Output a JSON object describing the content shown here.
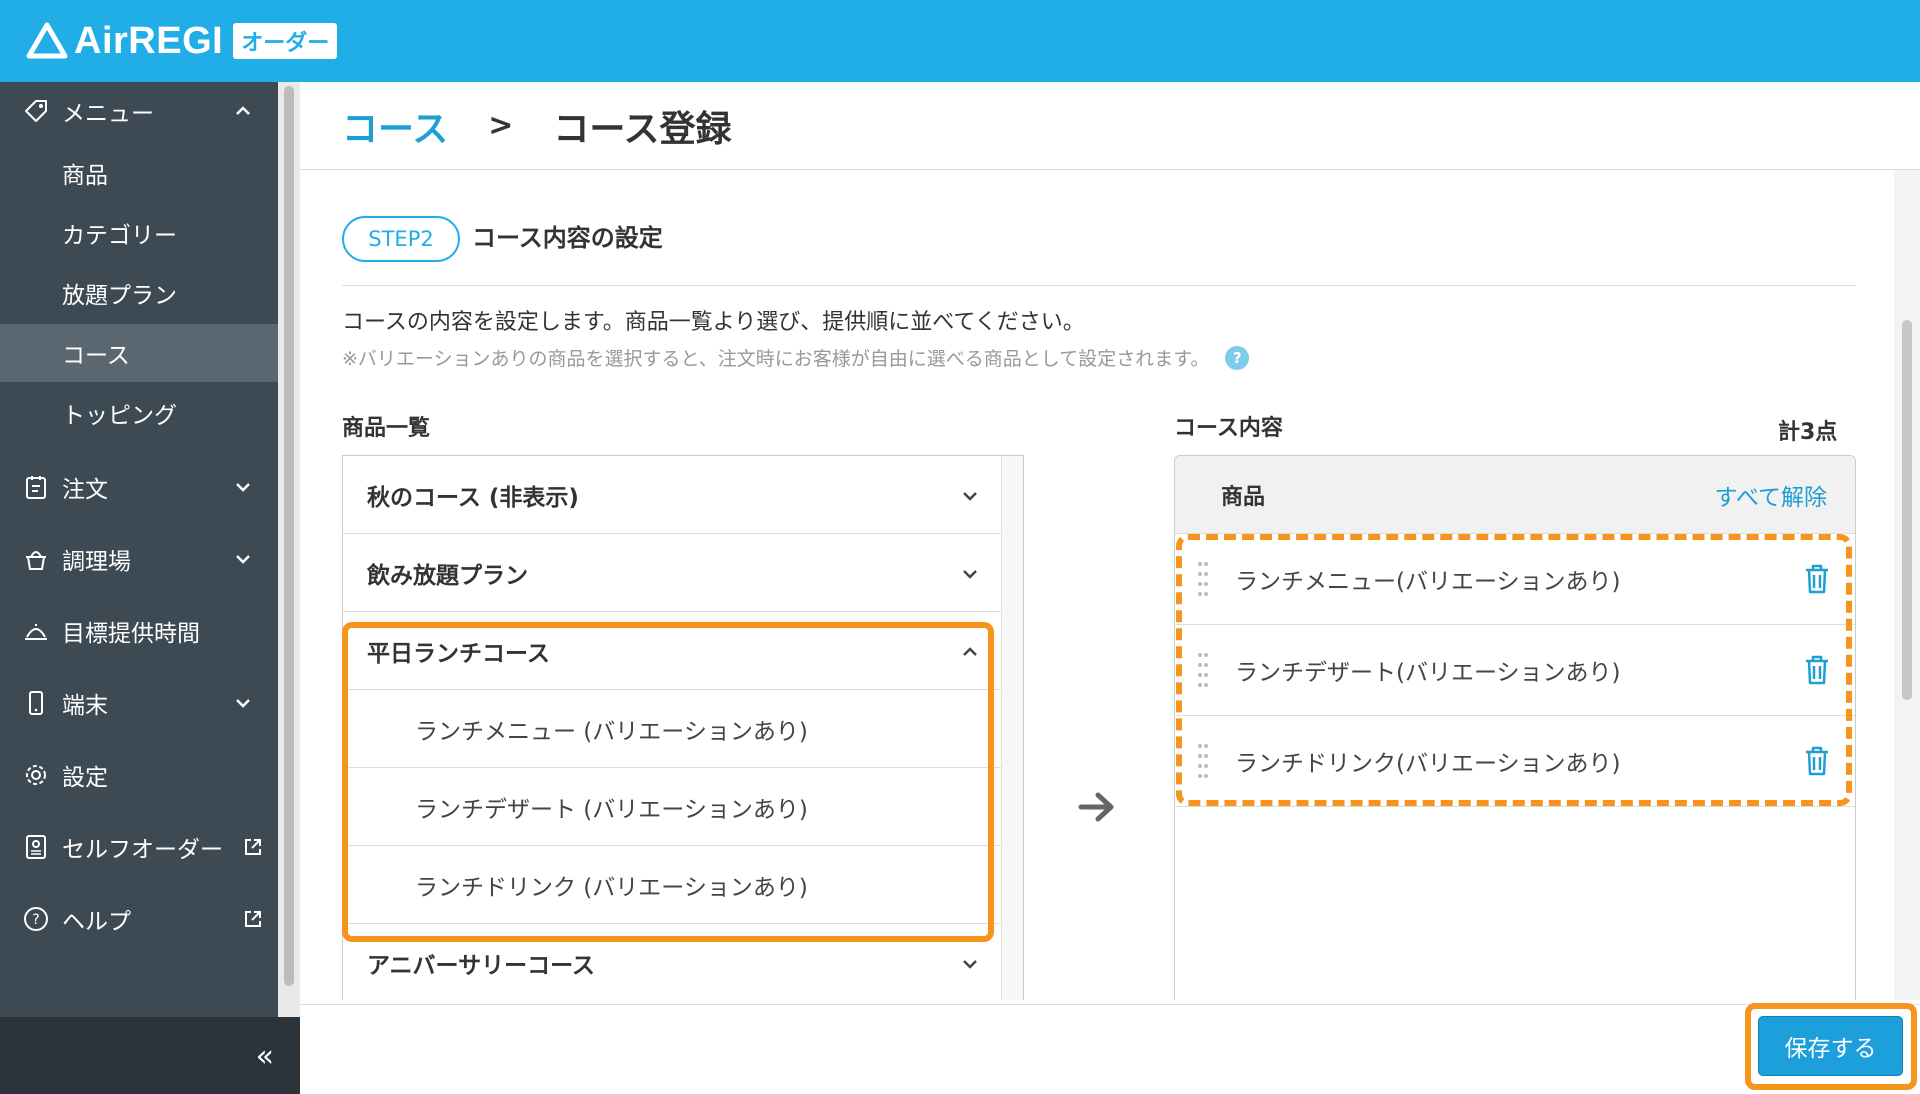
{
  "app": {
    "name": "AirREGI",
    "badge": "オーダー"
  },
  "sidebar": {
    "menu": {
      "label": "メニュー",
      "icon": "tag-icon"
    },
    "menu_sub": [
      "商品",
      "カテゴリー",
      "放題プラン",
      "コース",
      "トッピング"
    ],
    "active_sub": "コース",
    "items": [
      {
        "label": "注文",
        "icon": "order-icon",
        "expandable": true
      },
      {
        "label": "調理場",
        "icon": "kitchen-icon",
        "expandable": true
      },
      {
        "label": "目標提供時間",
        "icon": "cloche-icon",
        "expandable": false
      },
      {
        "label": "端末",
        "icon": "phone-icon",
        "expandable": true
      },
      {
        "label": "設定",
        "icon": "gear-icon",
        "expandable": false
      },
      {
        "label": "セルフオーダー",
        "icon": "selforder-icon",
        "external": true
      },
      {
        "label": "ヘルプ",
        "icon": "help-icon",
        "external": true
      }
    ],
    "collapse_label": "«"
  },
  "breadcrumb": {
    "parent": "コース",
    "separator": ">",
    "current": "コース登録"
  },
  "step": {
    "badge": "STEP2",
    "title": "コース内容の設定"
  },
  "description": {
    "line1": "コースの内容を設定します。商品一覧より選び、提供順に並べてください。",
    "line2": "※バリエーションありの商品を選択すると、注文時にお客様が自由に選べる商品として設定されます。",
    "help": "?"
  },
  "product_list": {
    "title": "商品一覧",
    "categories": [
      {
        "name": "秋のコース (非表示)"
      },
      {
        "name": "飲み放題プラン"
      },
      {
        "name": "平日ランチコース",
        "expanded": true,
        "items": [
          "ランチメニュー (バリエーションあり)",
          "ランチデザート (バリエーションあり)",
          "ランチドリンク (バリエーションあり)"
        ]
      },
      {
        "name": "アニバーサリーコース"
      }
    ]
  },
  "course_content": {
    "title": "コース内容",
    "total": "計3点",
    "header": "商品",
    "clear_all": "すべて解除",
    "items": [
      "ランチメニュー(バリエーションあり)",
      "ランチデザート(バリエーションあり)",
      "ランチドリンク(バリエーションあり)"
    ]
  },
  "footer": {
    "save_label": "保存する"
  },
  "colors": {
    "brand": "#21ade5",
    "highlight": "#f7941d",
    "sidebar": "#3e4a53",
    "link": "#1e9fd2"
  }
}
